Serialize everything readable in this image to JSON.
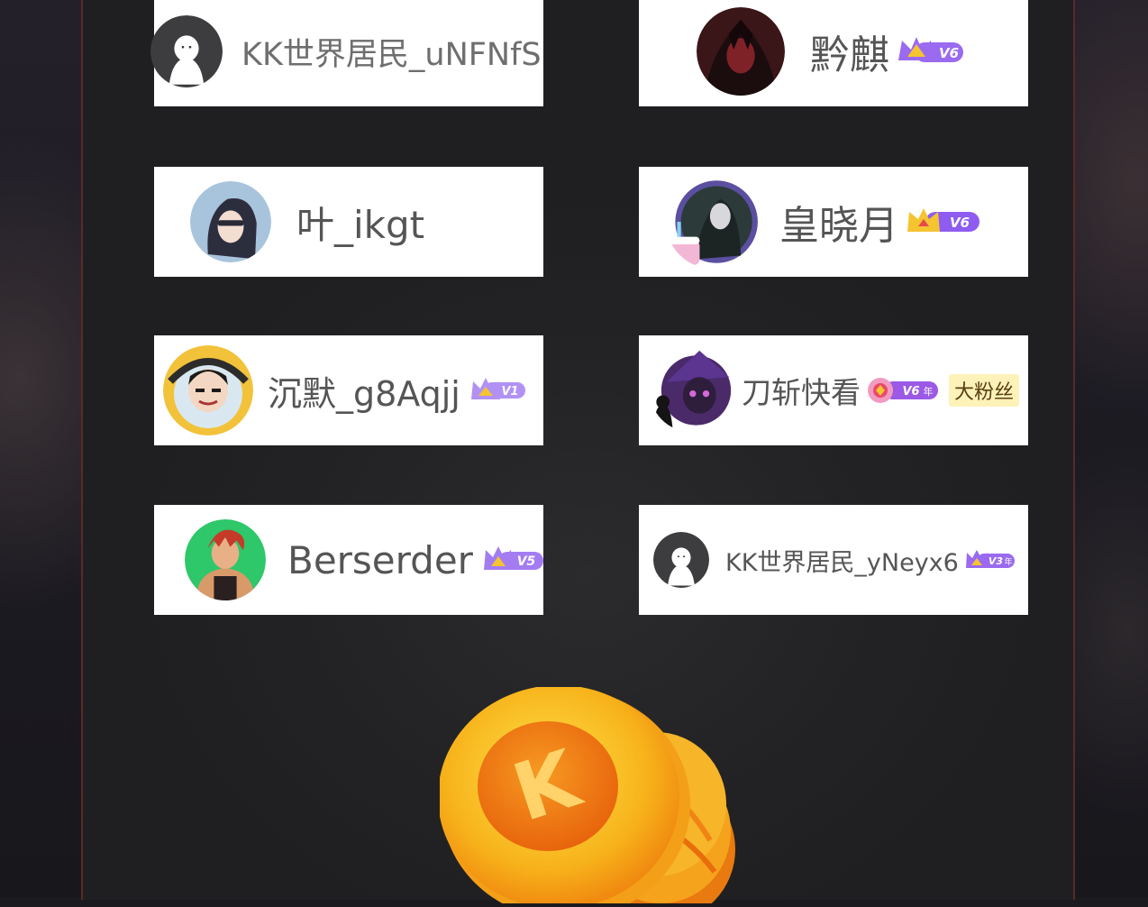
{
  "users": [
    {
      "name": "KK世界居民_uNFNfS",
      "badge": "",
      "badge_year": "",
      "fan_badge": ""
    },
    {
      "name": "黔麒",
      "badge": "V6",
      "badge_year": "",
      "fan_badge": ""
    },
    {
      "name": "叶_ikgt",
      "badge": "",
      "badge_year": "",
      "fan_badge": ""
    },
    {
      "name": "皇晓月",
      "badge": "V6",
      "badge_year": "",
      "fan_badge": ""
    },
    {
      "name": "沉默_g8Aqjj",
      "badge": "V1",
      "badge_year": "",
      "fan_badge": ""
    },
    {
      "name": "刀斩快看",
      "badge": "V6",
      "badge_year": "年",
      "fan_badge": "大粉丝"
    },
    {
      "name": "Berserder",
      "badge": "V5",
      "badge_year": "",
      "fan_badge": ""
    },
    {
      "name": "KK世界居民_yNeyx6",
      "badge": "V3",
      "badge_year": "年",
      "fan_badge": ""
    }
  ],
  "coin": {
    "letter": "K"
  },
  "colors": {
    "card_bg": "#ffffff",
    "name_text": "#6e6e6e",
    "badge_purple": "#9a6af0",
    "crown_gold": "#f4c431",
    "panel_border": "#5a2a26",
    "coin_orange": "#f28a16"
  },
  "icons": {
    "default_avatar": "ghost-avatar-icon",
    "crown": "crown-icon",
    "coin": "k-coin-icon"
  }
}
